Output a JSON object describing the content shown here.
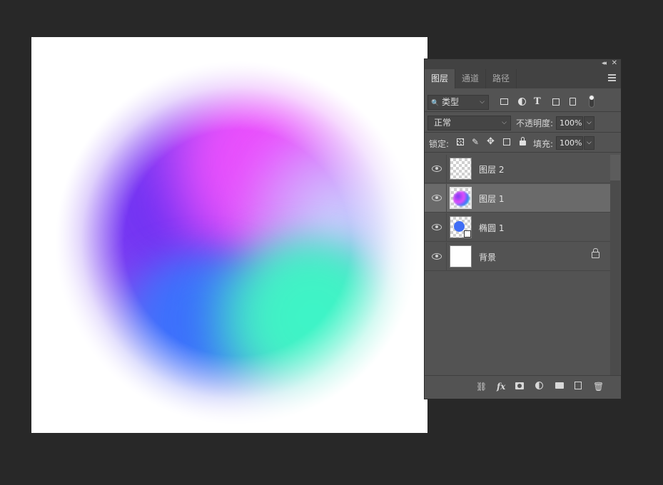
{
  "panel": {
    "collapse_glyph": "◂◂",
    "close_glyph": "✕",
    "tabs": [
      {
        "label": "图层",
        "active": true
      },
      {
        "label": "通道",
        "active": false
      },
      {
        "label": "路径",
        "active": false
      }
    ],
    "filter": {
      "search_glyph": "🔍",
      "label": "类型",
      "caret": "⌵"
    },
    "blend_mode": {
      "label": "正常",
      "caret": "⌵"
    },
    "opacity": {
      "label": "不透明度:",
      "value": "100%",
      "caret": "⌵"
    },
    "lock": {
      "label": "锁定:"
    },
    "fill": {
      "label": "填充:",
      "value": "100%",
      "caret": "⌵"
    },
    "layers": [
      {
        "name": "图层 2",
        "thumb": "transparent",
        "selected": false,
        "locked": false
      },
      {
        "name": "图层 1",
        "thumb": "gradient-blob",
        "selected": true,
        "locked": false
      },
      {
        "name": "椭圆 1",
        "thumb": "ellipse-shape",
        "selected": false,
        "locked": false
      },
      {
        "name": "背景",
        "thumb": "white",
        "selected": false,
        "locked": true
      }
    ],
    "filter_icons": [
      "image-filter-icon",
      "adjustment-filter-icon",
      "type-filter-icon",
      "shape-filter-icon",
      "smart-object-filter-icon",
      "filter-toggle-icon"
    ],
    "footer_icons": [
      "link-layers-icon",
      "fx-icon",
      "layer-mask-icon",
      "adjustment-layer-icon",
      "group-folder-icon",
      "new-layer-icon",
      "trash-icon"
    ]
  },
  "colors": {
    "app_bg": "#282828",
    "panel_bg": "#535353",
    "selected_row": "#6a6a6a",
    "violet": "#6a2cf4",
    "magenta": "#ee4cff",
    "blue": "#3a6bff",
    "mint": "#3bf6c8"
  }
}
